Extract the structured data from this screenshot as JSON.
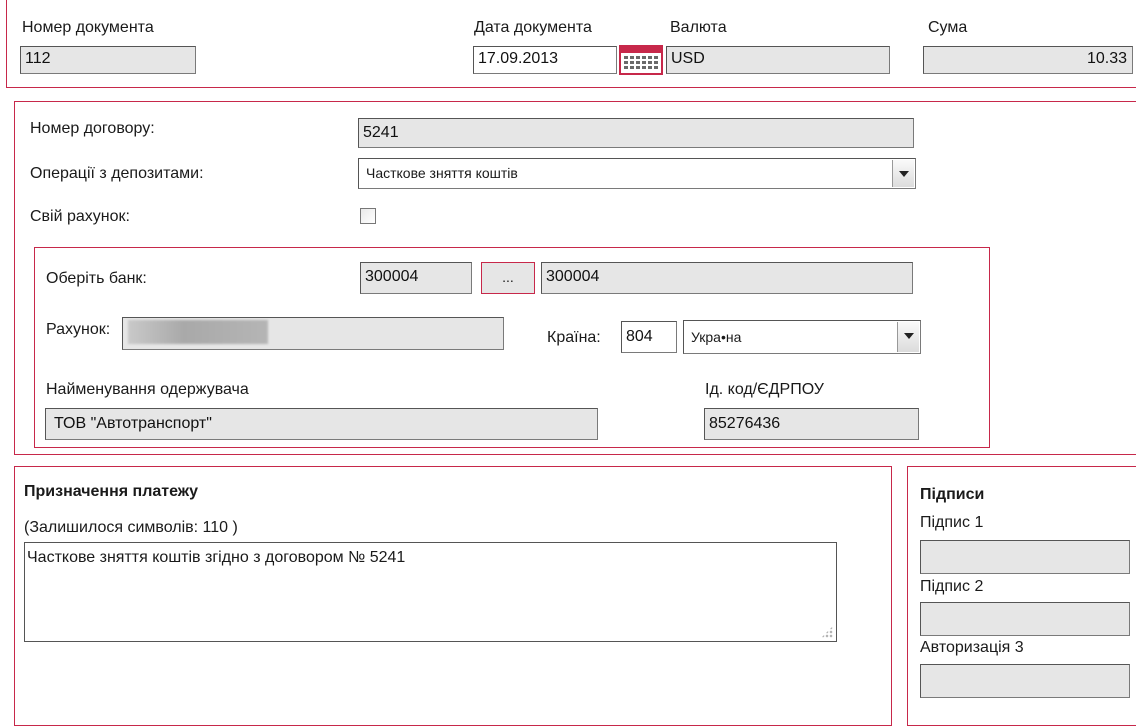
{
  "header": {
    "doc_number_label": "Номер документа",
    "doc_number_value": "112",
    "doc_date_label": "Дата документа",
    "doc_date_value": "17.09.2013",
    "currency_label": "Валюта",
    "currency_value": "USD",
    "amount_label": "Сума",
    "amount_value": "10.33"
  },
  "contract": {
    "number_label": "Номер договору:",
    "number_value": "5241",
    "operations_label": "Операції з депозитами:",
    "operations_value": "Часткове зняття коштів",
    "own_account_label": "Свій рахунок:"
  },
  "bank": {
    "choose_bank_label": "Оберіть банк:",
    "bank_code": "300004",
    "browse_label": "...",
    "bank_name": "300004",
    "account_label": "Рахунок:",
    "country_label": "Країна:",
    "country_code": "804",
    "country_name": "Укра•на",
    "recipient_name_label": "Найменування одержувача",
    "recipient_name_value": "ТОВ \"Автотранспорт\"",
    "id_code_label": "Ід. код/ЄДРПОУ",
    "id_code_value": "85276436"
  },
  "payment": {
    "title": "Призначення платежу",
    "remaining_chars": "(Залишилося символів: 110   )",
    "purpose_text": "Часткове зняття коштів згідно з договором № 5241"
  },
  "signatures": {
    "title": "Підписи",
    "sign1_label": "Підпис 1",
    "sign2_label": "Підпис 2",
    "auth3_label": "Авторизація 3"
  },
  "colors": {
    "frame": "#c7284a",
    "field_bg": "#e6e6e6"
  },
  "icons": {
    "calendar": "calendar-icon",
    "dropdown": "chevron-down-icon",
    "resize": "resize-grip-icon"
  }
}
